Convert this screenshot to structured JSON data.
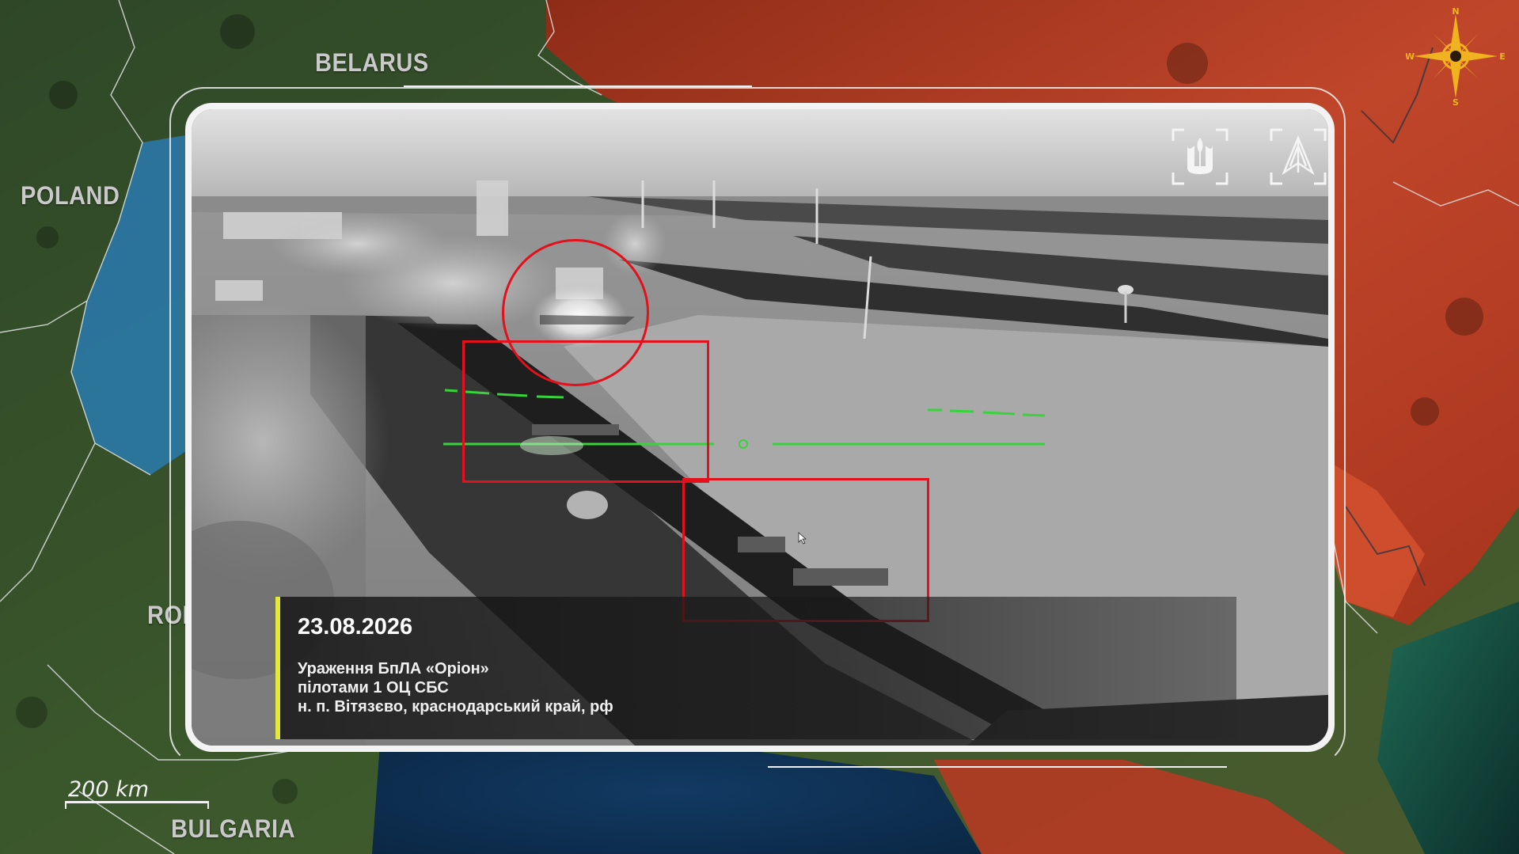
{
  "map": {
    "labels": {
      "belarus": "BELARUS",
      "poland": "POLAND",
      "romania": "ROM",
      "bulgaria": "BULGARIA"
    },
    "scale_label": "200 km",
    "compass": {
      "n": "N",
      "e": "E",
      "s": "S",
      "w": "W"
    },
    "colors": {
      "land_west": "#2f4a26",
      "land_east": "#b63a22",
      "water": "#1a3f66",
      "highlight_blue": "#2a78a6"
    }
  },
  "video": {
    "icons": [
      "trident-icon",
      "wings-icon"
    ],
    "marker_color": "#e2111b",
    "hud_color": "#37d33b",
    "caption": {
      "date": "23.08.2026",
      "line1": "Ураження БпЛА «Оріон»",
      "line2": "пілотами 1 ОЦ СБС",
      "line3": "н. п. Вітязєво, краснодарський край, рф",
      "accent_color": "#e4e93a"
    }
  }
}
